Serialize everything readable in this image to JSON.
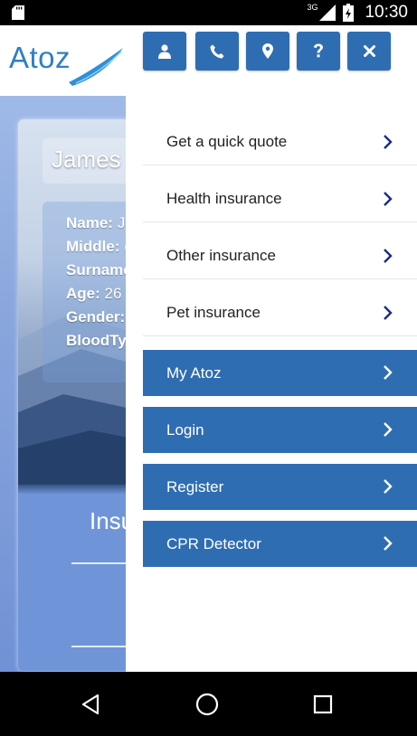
{
  "status_bar": {
    "network": "3G",
    "time": "10:30",
    "icons": [
      "sd-card-icon",
      "signal-icon",
      "battery-charging-icon"
    ]
  },
  "header": {
    "logo_text": "Atoz"
  },
  "background_page": {
    "name_title": "James",
    "details": [
      {
        "key": "Name:",
        "value": "J"
      },
      {
        "key": "Middle:",
        "value": "("
      },
      {
        "key": "Surname",
        "value": ""
      },
      {
        "key": "Age:",
        "value": "26"
      },
      {
        "key": "Gender:",
        "value": ""
      },
      {
        "key": "BloodTy",
        "value": ""
      }
    ],
    "section_title": "Insu"
  },
  "drawer": {
    "icon_buttons": [
      {
        "name": "profile-button",
        "icon": "user-icon"
      },
      {
        "name": "call-button",
        "icon": "phone-icon"
      },
      {
        "name": "location-button",
        "icon": "map-marker-icon"
      },
      {
        "name": "help-button",
        "icon": "question-icon"
      },
      {
        "name": "close-button",
        "icon": "close-icon"
      }
    ],
    "menu": [
      {
        "label": "Get a quick quote",
        "style": "light"
      },
      {
        "label": "Health insurance",
        "style": "light"
      },
      {
        "label": "Other insurance",
        "style": "light"
      },
      {
        "label": "Pet insurance",
        "style": "light"
      },
      {
        "label": "My Atoz",
        "style": "dark"
      },
      {
        "label": "Login",
        "style": "dark"
      },
      {
        "label": "Register",
        "style": "dark"
      },
      {
        "label": "CPR Detector",
        "style": "dark"
      }
    ]
  },
  "colors": {
    "primary": "#2f6db2",
    "logo": "#2f7fc8",
    "chevron_light": "#1a2a8a"
  },
  "nav_bar": {
    "buttons": [
      "back-icon",
      "home-icon",
      "recents-icon"
    ]
  }
}
